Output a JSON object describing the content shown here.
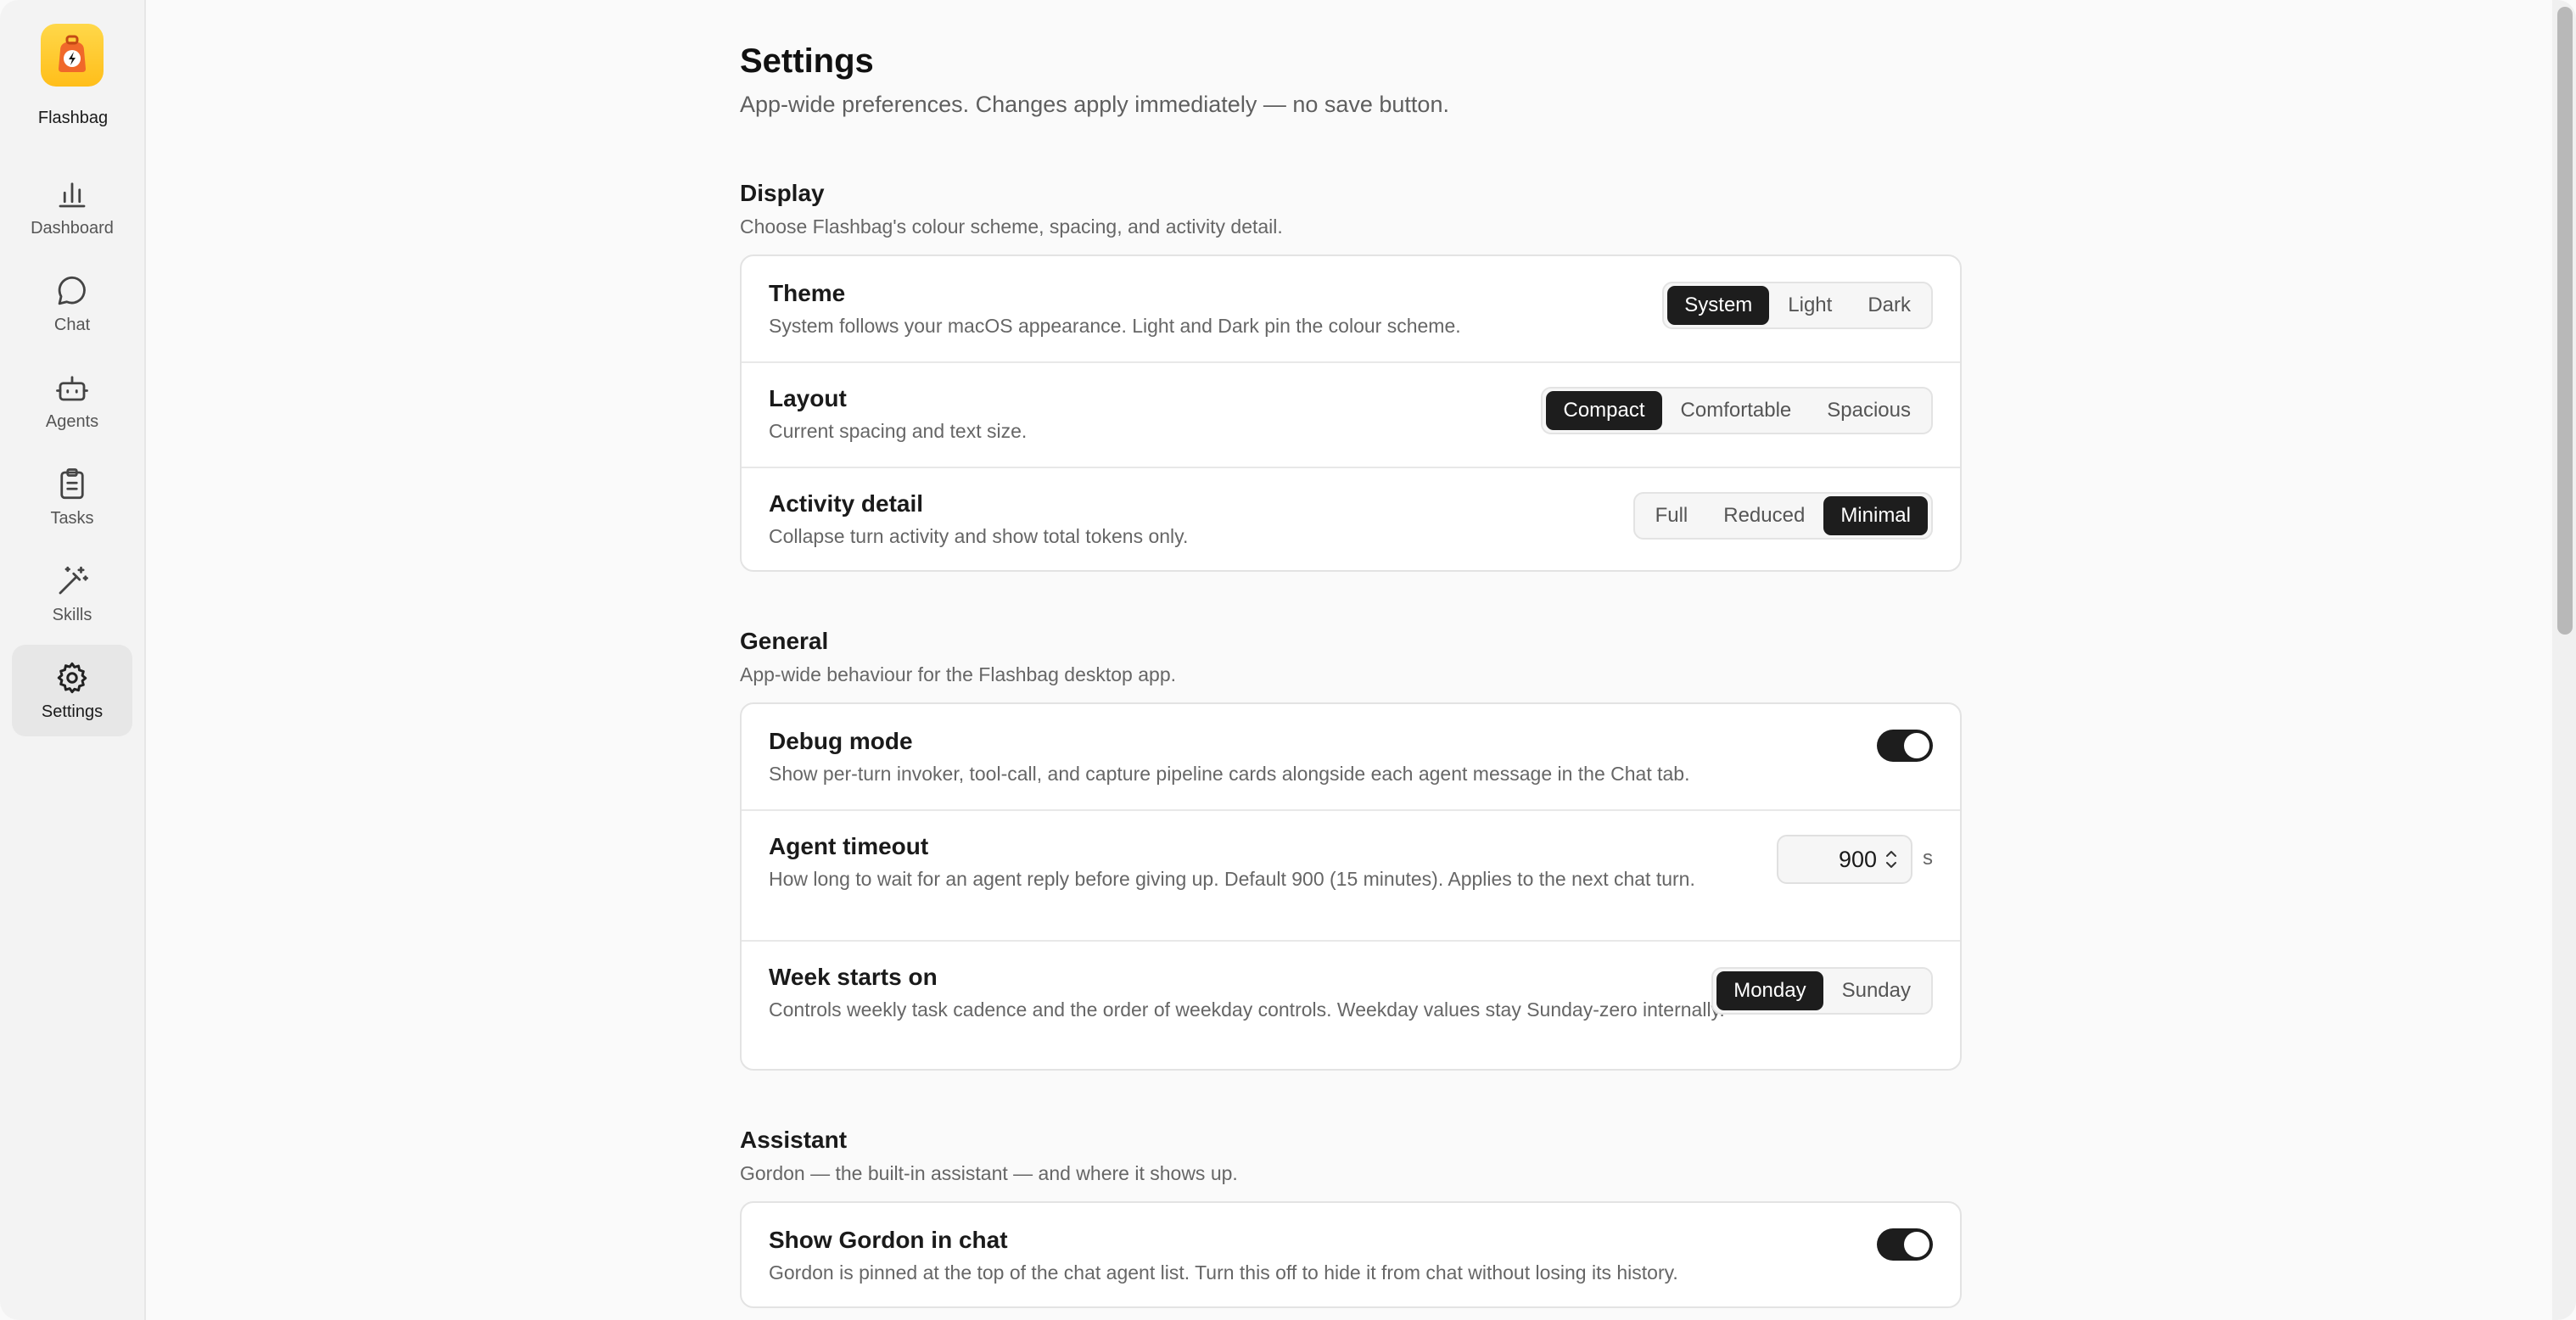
{
  "app": {
    "name": "Flashbag"
  },
  "nav": [
    {
      "label": "Dashboard",
      "icon": "bar-chart-icon"
    },
    {
      "label": "Chat",
      "icon": "chat-bubble-icon"
    },
    {
      "label": "Agents",
      "icon": "robot-icon"
    },
    {
      "label": "Tasks",
      "icon": "clipboard-icon"
    },
    {
      "label": "Skills",
      "icon": "magic-wand-icon"
    },
    {
      "label": "Settings",
      "icon": "gear-icon",
      "active": true
    }
  ],
  "page": {
    "title": "Settings",
    "subtitle": "App-wide preferences. Changes apply immediately — no save button."
  },
  "display": {
    "title": "Display",
    "desc": "Choose Flashbag's colour scheme, spacing, and activity detail.",
    "theme": {
      "title": "Theme",
      "desc": "System follows your macOS appearance. Light and Dark pin the colour scheme.",
      "options": [
        "System",
        "Light",
        "Dark"
      ],
      "selected": "System"
    },
    "layout": {
      "title": "Layout",
      "desc": "Current spacing and text size.",
      "options": [
        "Compact",
        "Comfortable",
        "Spacious"
      ],
      "selected": "Compact"
    },
    "activity": {
      "title": "Activity detail",
      "desc": "Collapse turn activity and show total tokens only.",
      "options": [
        "Full",
        "Reduced",
        "Minimal"
      ],
      "selected": "Minimal"
    }
  },
  "general": {
    "title": "General",
    "desc": "App-wide behaviour for the Flashbag desktop app.",
    "debug": {
      "title": "Debug mode",
      "desc": "Show per-turn invoker, tool-call, and capture pipeline cards alongside each agent message in the Chat tab.",
      "enabled": true
    },
    "timeout": {
      "title": "Agent timeout",
      "desc": "How long to wait for an agent reply before giving up. Default 900 (15 minutes). Applies to the next chat turn.",
      "value": "900",
      "unit": "s"
    },
    "week": {
      "title": "Week starts on",
      "desc": "Controls weekly task cadence and the order of weekday controls. Weekday values stay Sunday-zero internally.",
      "options": [
        "Monday",
        "Sunday"
      ],
      "selected": "Monday"
    }
  },
  "assistant": {
    "title": "Assistant",
    "desc": "Gordon — the built-in assistant — and where it shows up.",
    "gordon": {
      "title": "Show Gordon in chat",
      "desc": "Gordon is pinned at the top of the chat agent list. Turn this off to hide it from chat without losing its history.",
      "enabled": true
    }
  },
  "colors": {
    "accent": "#1d1d1d",
    "logo": "#ffc928",
    "background": "#fafafa"
  }
}
